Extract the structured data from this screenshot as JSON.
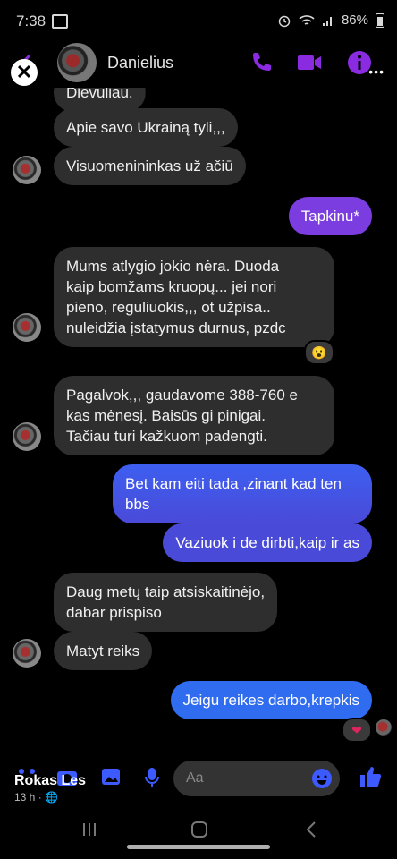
{
  "status_bar": {
    "time": "7:38",
    "battery": "86%"
  },
  "header": {
    "contact_name": "Danielius"
  },
  "colors": {
    "accent": "#8a2be2",
    "sent_blue": "#2f6cf0",
    "sent_violet": "#7b3de0",
    "received": "#2e2e2e"
  },
  "messages": [
    {
      "text": "Dievuliau."
    },
    {
      "text": "Apie savo Ukrainą tyli,,,"
    },
    {
      "text": "Visuomenininkas už ačiū"
    },
    {
      "text": "Tapkinu*"
    },
    {
      "lines": [
        "Mums atlygio jokio nėra. Duoda",
        "kaip bomžams kruopų... jei nori",
        "pieno, reguliuokis,,, ot užpisa..",
        "nuleidžia įstatymus durnus, pzdc"
      ]
    },
    {
      "lines": [
        "Pagalvok,,, gaudavome 388-760 e",
        "kas mėnesį. Baisūs gi pinigai.",
        "Tačiau turi kažkuom padengti."
      ]
    },
    {
      "lines": [
        "Bet kam eiti tada ,zinant kad ten",
        "bbs"
      ]
    },
    {
      "text": "Vaziuok i de dirbti,kaip ir as"
    },
    {
      "lines": [
        "Daug metų taip atsiskaitinėjo,",
        "dabar prispiso"
      ]
    },
    {
      "text": "Matyt reiks"
    },
    {
      "text": "Jeigu reikes darbo,krepkis"
    }
  ],
  "reactions": {
    "surprised": "😮",
    "heart": "❤"
  },
  "composer": {
    "placeholder": "Aa"
  },
  "post_overlay": {
    "author": "Rokas Les",
    "age": "13 h ·"
  }
}
